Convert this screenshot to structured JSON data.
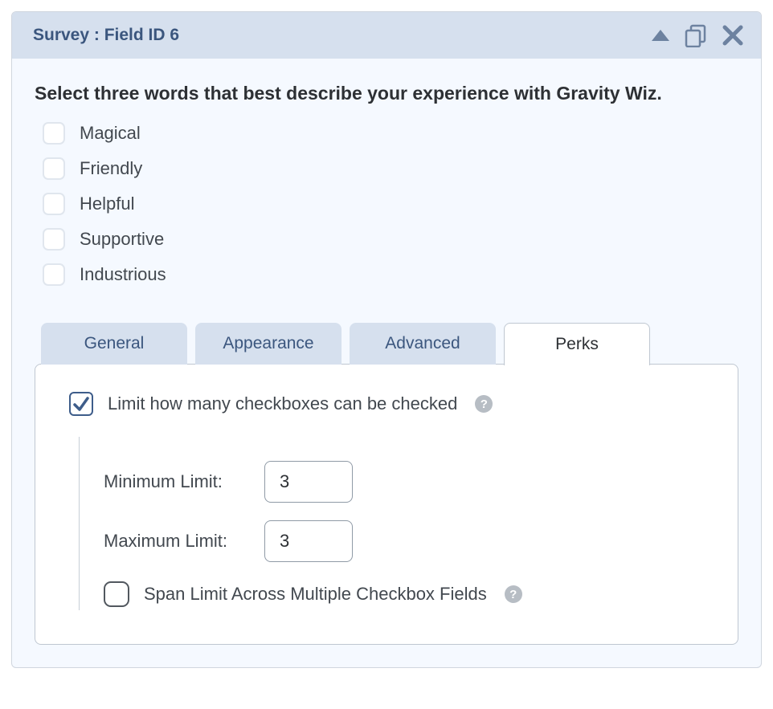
{
  "header": {
    "title": "Survey : Field ID 6"
  },
  "survey": {
    "prompt": "Select three words that best describe your experience with Gravity Wiz.",
    "options": [
      {
        "label": "Magical",
        "checked": false
      },
      {
        "label": "Friendly",
        "checked": false
      },
      {
        "label": "Helpful",
        "checked": false
      },
      {
        "label": "Supportive",
        "checked": false
      },
      {
        "label": "Industrious",
        "checked": false
      }
    ]
  },
  "tabs": [
    {
      "label": "General",
      "active": false
    },
    {
      "label": "Appearance",
      "active": false
    },
    {
      "label": "Advanced",
      "active": false
    },
    {
      "label": "Perks",
      "active": true
    }
  ],
  "perks": {
    "limit_label": "Limit how many checkboxes can be checked",
    "limit_enabled": true,
    "min_label": "Minimum Limit:",
    "min_value": "3",
    "max_label": "Maximum Limit:",
    "max_value": "3",
    "span_label": "Span Limit Across Multiple Checkbox Fields",
    "span_checked": false,
    "help_glyph": "?"
  }
}
